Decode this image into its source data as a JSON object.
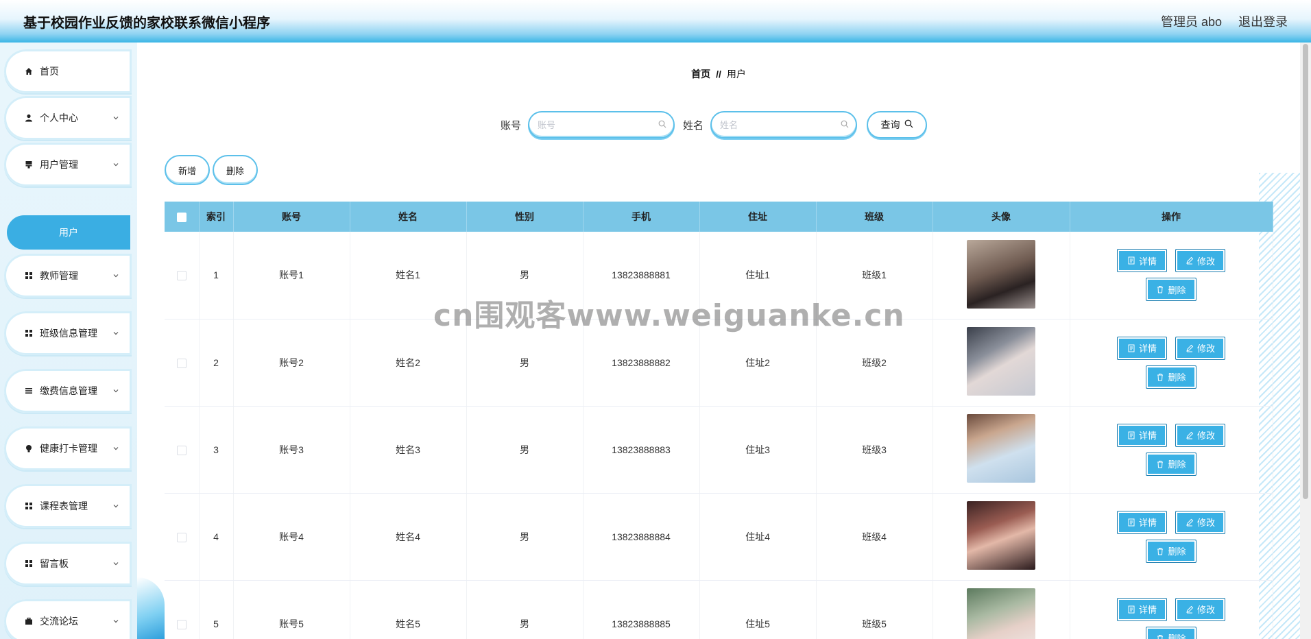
{
  "header": {
    "title": "基于校园作业反馈的家校联系微信小程序",
    "user": "管理员 abo",
    "logout": "退出登录"
  },
  "sidebar": {
    "items": [
      {
        "label": "首页",
        "icon": "home-icon"
      },
      {
        "label": "个人中心",
        "icon": "user-icon"
      },
      {
        "label": "用户管理",
        "icon": "stamp-icon"
      },
      {
        "label": "教师管理",
        "icon": "grid-icon"
      },
      {
        "label": "班级信息管理",
        "icon": "grid-icon"
      },
      {
        "label": "缴费信息管理",
        "icon": "list-icon"
      },
      {
        "label": "健康打卡管理",
        "icon": "bulb-icon"
      },
      {
        "label": "课程表管理",
        "icon": "grid-icon"
      },
      {
        "label": "留言板",
        "icon": "grid-icon"
      },
      {
        "label": "交流论坛",
        "icon": "briefcase-icon"
      }
    ],
    "active_sub": "用户"
  },
  "breadcrumb": {
    "home": "首页",
    "sep": "//",
    "current": "用户"
  },
  "search": {
    "account_label": "账号",
    "account_placeholder": "账号",
    "name_label": "姓名",
    "name_placeholder": "姓名",
    "query_button": "查询"
  },
  "actions": {
    "add": "新增",
    "delete": "删除"
  },
  "table": {
    "columns": [
      "索引",
      "账号",
      "姓名",
      "性别",
      "手机",
      "住址",
      "班级",
      "头像",
      "操作"
    ],
    "rows": [
      {
        "index": "1",
        "account": "账号1",
        "name": "姓名1",
        "gender": "男",
        "phone": "13823888881",
        "address": "住址1",
        "class": "班级1"
      },
      {
        "index": "2",
        "account": "账号2",
        "name": "姓名2",
        "gender": "男",
        "phone": "13823888882",
        "address": "住址2",
        "class": "班级2"
      },
      {
        "index": "3",
        "account": "账号3",
        "name": "姓名3",
        "gender": "男",
        "phone": "13823888883",
        "address": "住址3",
        "class": "班级3"
      },
      {
        "index": "4",
        "account": "账号4",
        "name": "姓名4",
        "gender": "男",
        "phone": "13823888884",
        "address": "住址4",
        "class": "班级4"
      },
      {
        "index": "5",
        "account": "账号5",
        "name": "姓名5",
        "gender": "男",
        "phone": "13823888885",
        "address": "住址5",
        "class": "班级5"
      }
    ],
    "op_detail": "详情",
    "op_edit": "修改",
    "op_delete": "删除"
  },
  "watermark": "cn围观客www.weiguanke.cn",
  "colors": {
    "accent": "#3aaee3",
    "header_bg": "#7ac6e6"
  }
}
